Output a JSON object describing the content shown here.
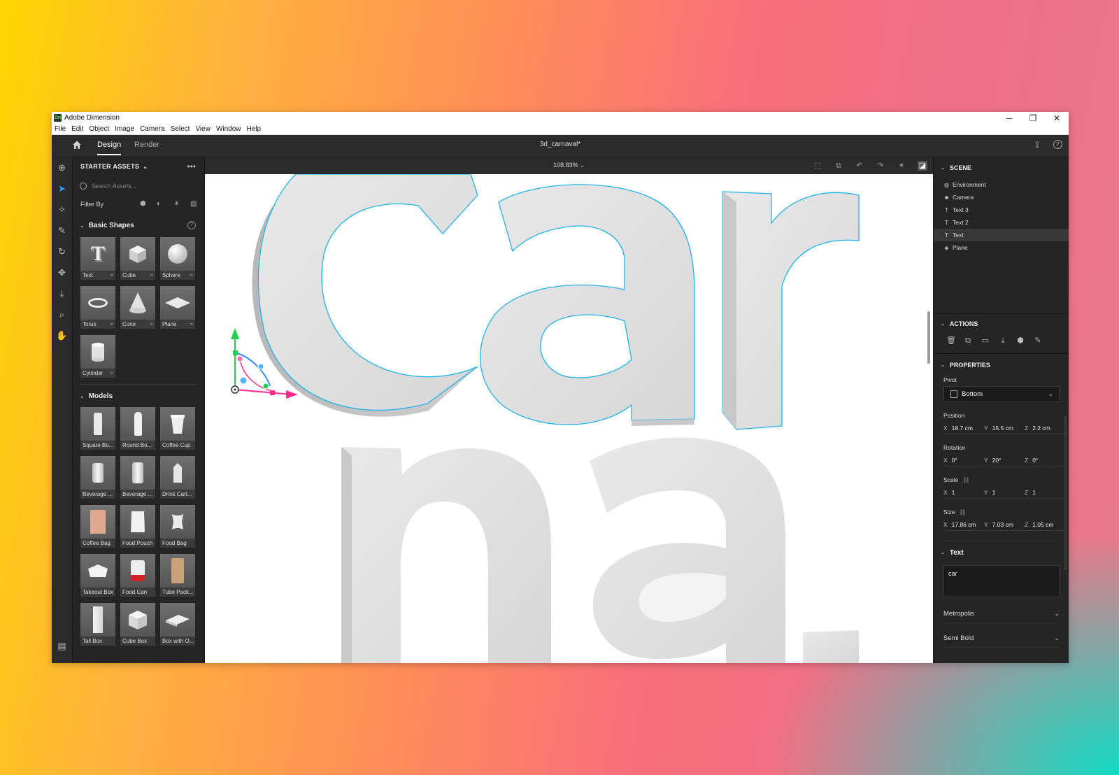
{
  "window": {
    "app_title": "Adobe Dimension",
    "logo_text": "Dn",
    "minimize": "─",
    "maximize": "❐",
    "close": "✕"
  },
  "menu": [
    "File",
    "Edit",
    "Object",
    "Image",
    "Camera",
    "Select",
    "View",
    "Window",
    "Help"
  ],
  "topbar": {
    "tabs": [
      "Design",
      "Render"
    ],
    "active_tab": "Design",
    "document_title": "3d_carnaval*"
  },
  "assets": {
    "title": "STARTER ASSETS",
    "search_placeholder": "Search Assets...",
    "filter_label": "Filter By",
    "basic_shapes_title": "Basic Shapes",
    "basic_shapes": [
      "Text",
      "Cube",
      "Sphere",
      "Torus",
      "Cone",
      "Plane",
      "Cylinder"
    ],
    "models_title": "Models",
    "models": [
      "Square Bo...",
      "Round Bo...",
      "Coffee Cup",
      "Beverage ...",
      "Beverage ...",
      "Drink Cart...",
      "Coffee Bag",
      "Food Pouch",
      "Food Bag",
      "Takeout Box",
      "Food Can",
      "Tube Pack...",
      "Tall Box",
      "Cube Box",
      "Box with O..."
    ]
  },
  "canvas": {
    "zoom": "108.83%"
  },
  "scene": {
    "title": "SCENE",
    "items": [
      {
        "label": "Environment",
        "icon": "globe-icon"
      },
      {
        "label": "Camera",
        "icon": "camera-icon"
      },
      {
        "label": "Text 3",
        "icon": "text-icon"
      },
      {
        "label": "Text 2",
        "icon": "text-icon"
      },
      {
        "label": "Text",
        "icon": "text-icon",
        "selected": true
      },
      {
        "label": "Plane",
        "icon": "plane-icon"
      }
    ]
  },
  "actions": {
    "title": "ACTIONS"
  },
  "properties": {
    "title": "PROPERTIES",
    "pivot_label": "Pivot",
    "pivot_value": "Bottom",
    "position_label": "Position",
    "position": {
      "x": "18.7 cm",
      "y": "15.5 cm",
      "z": "2.2 cm"
    },
    "rotation_label": "Rotation",
    "rotation": {
      "x": "0°",
      "y": "20°",
      "z": "0°"
    },
    "scale_label": "Scale",
    "scale": {
      "x": "1",
      "y": "1",
      "z": "1"
    },
    "size_label": "Size",
    "size": {
      "x": "17.86 cm",
      "y": "7.03 cm",
      "z": "1.05 cm"
    },
    "text_section": "Text",
    "text_value": "car",
    "font": "Metropolis",
    "weight": "Semi Bold"
  },
  "axis_labels": {
    "x": "X",
    "y": "Y",
    "z": "Z"
  },
  "colors": {
    "accent": "#2d9fff",
    "selection_outline": "#21b2ea",
    "gizmo_x": "#ff2a8a",
    "gizmo_y": "#1fd14c",
    "gizmo_z": "#2d8cff"
  }
}
